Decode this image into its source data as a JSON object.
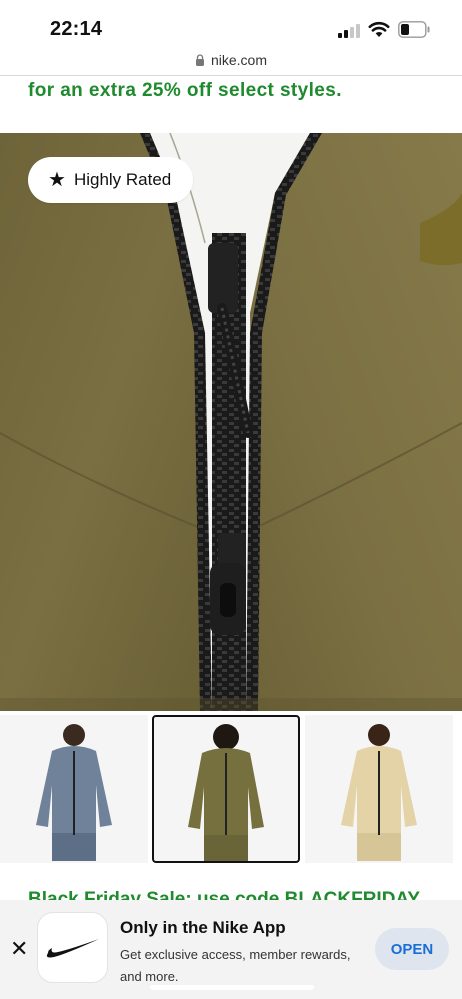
{
  "status_bar": {
    "time": "22:14"
  },
  "browser": {
    "url": "nike.com"
  },
  "promo": {
    "line": "for an extra 25% off select styles.",
    "next_line": "Black Friday Sale: use code BLACKFRIDAY"
  },
  "product": {
    "badge_label": "Highly Rated",
    "badge_icon": "star-icon",
    "thumbnails": [
      {
        "color_name": "blue-grey",
        "selected": false,
        "colour": "#6f829a"
      },
      {
        "color_name": "olive",
        "selected": true,
        "colour": "#76703f"
      },
      {
        "color_name": "tan",
        "selected": false,
        "colour": "#e3d3a6"
      }
    ]
  },
  "app_banner": {
    "title": "Only in the Nike App",
    "description": "Get exclusive access, member rewards, and more.",
    "open_label": "OPEN",
    "close_label": "✕"
  },
  "colors": {
    "promo_green": "#1f8a2e",
    "jacket_olive": "#766a3d",
    "open_button_text": "#1a6fd6"
  }
}
